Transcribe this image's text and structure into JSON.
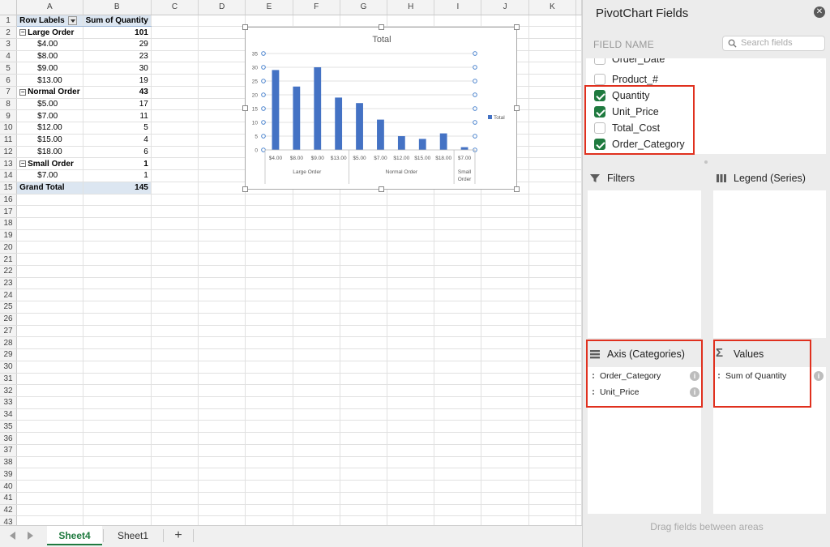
{
  "sheet": {
    "columns": [
      "A",
      "B",
      "C",
      "D",
      "E",
      "F",
      "G",
      "H",
      "I",
      "J",
      "K"
    ],
    "row_numbers": [
      "1",
      "2",
      "3",
      "4",
      "5",
      "6",
      "7",
      "8",
      "9",
      "10",
      "11",
      "12",
      "13",
      "14",
      "15",
      "16",
      "17",
      "18",
      "19",
      "20",
      "21",
      "22",
      "23",
      "24",
      "25",
      "26",
      "27",
      "28",
      "29",
      "30",
      "31",
      "32",
      "33",
      "34",
      "35",
      "36",
      "37",
      "38",
      "39",
      "40",
      "41",
      "42",
      "43"
    ],
    "pivot": {
      "header": {
        "row_labels": "Row Labels",
        "sum_label": "Sum of Quantity"
      },
      "groups": [
        {
          "label": "Large Order",
          "total": "101",
          "collapse": "−",
          "items": [
            {
              "price": "$4.00",
              "qty": "29"
            },
            {
              "price": "$8.00",
              "qty": "23"
            },
            {
              "price": "$9.00",
              "qty": "30"
            },
            {
              "price": "$13.00",
              "qty": "19"
            }
          ]
        },
        {
          "label": "Normal Order",
          "total": "43",
          "collapse": "−",
          "items": [
            {
              "price": "$5.00",
              "qty": "17"
            },
            {
              "price": "$7.00",
              "qty": "11"
            },
            {
              "price": "$12.00",
              "qty": "5"
            },
            {
              "price": "$15.00",
              "qty": "4"
            },
            {
              "price": "$18.00",
              "qty": "6"
            }
          ]
        },
        {
          "label": "Small Order",
          "total": "1",
          "collapse": "−",
          "items": [
            {
              "price": "$7.00",
              "qty": "1"
            }
          ]
        }
      ],
      "grand_total": {
        "label": "Grand Total",
        "value": "145"
      }
    }
  },
  "chart_data": {
    "type": "bar",
    "title": "Total",
    "categories": [
      "$4.00",
      "$8.00",
      "$9.00",
      "$13.00",
      "$5.00",
      "$7.00",
      "$12.00",
      "$15.00",
      "$18.00",
      "$7.00"
    ],
    "groups": [
      {
        "label": "Large Order",
        "count": 4
      },
      {
        "label": "Normal Order",
        "count": 5
      },
      {
        "label": "Small Order",
        "count": 1
      }
    ],
    "series": [
      {
        "name": "Total",
        "values": [
          29,
          23,
          30,
          19,
          17,
          11,
          5,
          4,
          6,
          1
        ]
      }
    ],
    "ylim": [
      0,
      35
    ],
    "yticks": [
      "0",
      "5",
      "10",
      "15",
      "20",
      "25",
      "30",
      "35"
    ],
    "legend_position": "right",
    "colors": {
      "bar": "#4472c4",
      "grid": "#d9d9d9",
      "axis_text": "#595959"
    }
  },
  "tabs": {
    "items": [
      "Sheet4",
      "Sheet1"
    ],
    "active": 0,
    "add_label": "+"
  },
  "pane": {
    "title": "PivotChart Fields",
    "close_label": "✕",
    "field_name_label": "FIELD NAME",
    "search_placeholder": "Search fields",
    "fields": [
      {
        "label": "Order_Date",
        "checked": false
      },
      {
        "label": "Product_#",
        "checked": false
      },
      {
        "label": "Quantity",
        "checked": true
      },
      {
        "label": "Unit_Price",
        "checked": true
      },
      {
        "label": "Total_Cost",
        "checked": false
      },
      {
        "label": "Order_Category",
        "checked": true
      }
    ],
    "areas": {
      "filters": {
        "title": "Filters",
        "icon": "funnel-icon",
        "items": []
      },
      "legend": {
        "title": "Legend (Series)",
        "icon": "columns-icon",
        "items": []
      },
      "axis": {
        "title": "Axis (Categories)",
        "icon": "rows-icon",
        "items": [
          "Order_Category",
          "Unit_Price"
        ]
      },
      "values": {
        "title": "Values",
        "icon": "sigma-icon",
        "items": [
          "Sum of Quantity"
        ]
      }
    },
    "drag_hint": "Drag fields between areas",
    "info_label": "i",
    "highlight_color": "#e0301e",
    "accent_color": "#1f7a3f"
  }
}
